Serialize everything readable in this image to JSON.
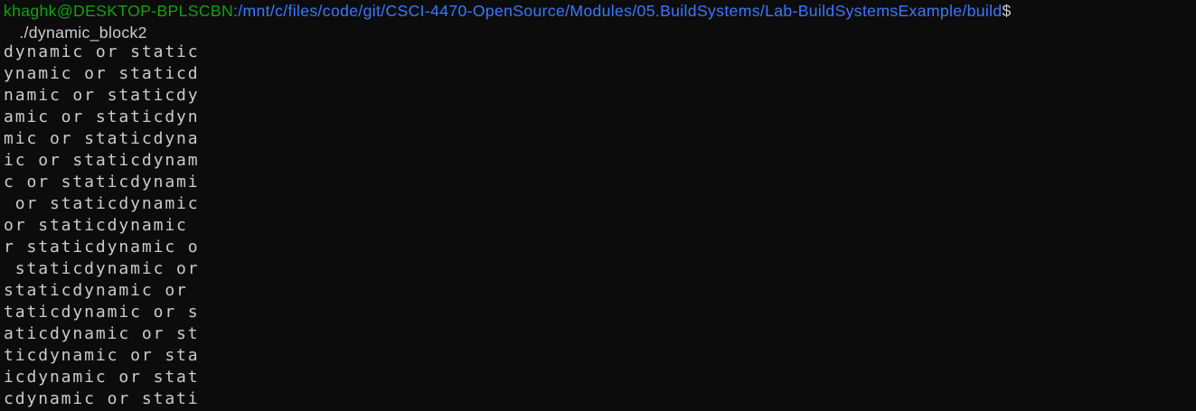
{
  "prompt": {
    "user_host": "khaghk@DESKTOP-BPLSCBN",
    "path": ":/mnt/c/files/code/git/CSCI-4470-OpenSource/Modules/05.BuildSystems/Lab-BuildSystemsExample/build",
    "symbol": "$"
  },
  "command": " ./dynamic_block2",
  "output": [
    "dynamic or static",
    "ynamic or staticd",
    "namic or staticdy",
    "amic or staticdyn",
    "mic or staticdyna",
    "ic or staticdynam",
    "c or staticdynami",
    " or staticdynamic",
    "or staticdynamic ",
    "r staticdynamic o",
    " staticdynamic or",
    "staticdynamic or ",
    "taticdynamic or s",
    "aticdynamic or st",
    "ticdynamic or sta",
    "icdynamic or stat",
    "cdynamic or stati"
  ],
  "colors": {
    "background": "#0c0c0c",
    "foreground": "#cccccc",
    "user_host": "#13a10e",
    "path": "#3b78ff"
  }
}
